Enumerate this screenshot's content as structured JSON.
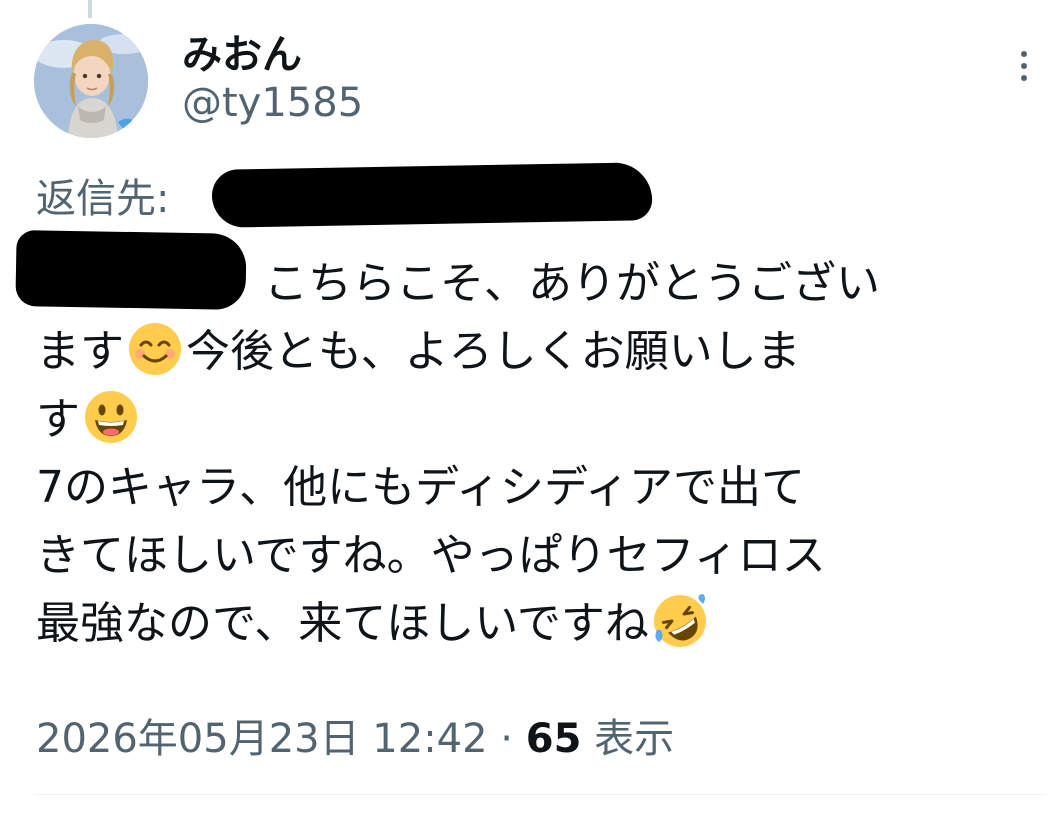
{
  "tweet": {
    "display_name": "みおん",
    "handle": "@ty1585",
    "reply_to_label": "返信先:",
    "body": {
      "line1": "こちらこそ、ありがとうござい",
      "line2a": "ます",
      "line2b": "今後とも、よろしくお願いしま",
      "line3": "す",
      "line4": "7のキャラ、他にもディシディアで出て",
      "line5": "きてほしいですね。やっぱりセフィロス",
      "line6": "最強なので、来てほしいですね"
    },
    "emojis": [
      "smiling-face-icon",
      "grinning-face-icon",
      "rofl-face-icon"
    ],
    "timestamp": "2026年05月23日 12:42",
    "separator": " · ",
    "views_count": "65",
    "views_label": "表示"
  },
  "icons": [
    "more-options-icon",
    "avatar"
  ],
  "colors": {
    "primary_text": "#0f1419",
    "secondary_text": "#536471",
    "divider": "#eff3f4",
    "thread_line": "#cfd9de"
  }
}
